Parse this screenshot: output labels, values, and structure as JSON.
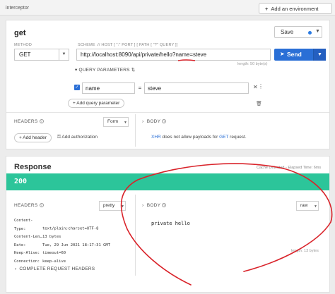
{
  "topbar": {
    "title": "interceptor",
    "add_env_label": "Add an environment",
    "add_env_icon": "plus-icon"
  },
  "request": {
    "name": "get",
    "save_label": "Save",
    "method_label": "METHOD",
    "method": "GET",
    "url_label": "SCHEME :// HOST [ \":\" PORT ] [ PATH [ \"?\" QUERY ]]",
    "url": "http://localhost:8090/api/private/hello?name=steve",
    "send_label": "Send",
    "length_hint": "length: 50 byte(s)",
    "query_params_label": "QUERY PARAMETERS",
    "params": [
      {
        "enabled": true,
        "key": "name",
        "value": "steve"
      }
    ],
    "add_param_label": "Add query parameter",
    "headers_label": "HEADERS",
    "body_label": "BODY",
    "body_format": "Form",
    "add_header_label": "Add header",
    "add_auth_label": "Add authorization",
    "xhr_note_prefix": "XHR",
    "xhr_note_mid": " does not allow payloads for ",
    "xhr_note_method": "GET",
    "xhr_note_suffix": " request."
  },
  "response": {
    "title": "Response",
    "meta": "Cache Detected - Elapsed Time: 6ms",
    "status_code": "200",
    "headers_label": "HEADERS",
    "headers_format": "pretty",
    "body_label": "BODY",
    "body_format": "raw",
    "headers": [
      {
        "key": "Content-Type:",
        "value": "text/plain;charset=UTF-8"
      },
      {
        "key": "Content-Len…",
        "value": "13 bytes"
      },
      {
        "key": "Date:",
        "value": "Tue, 29 Jun 2021 18:17:31 GMT"
      },
      {
        "key": "Keep-Alive:",
        "value": "timeout=60"
      },
      {
        "key": "Connection:",
        "value": "keep-alive"
      }
    ],
    "body_text": "private hello",
    "length_hint": "length: 13 bytes",
    "complete_headers_label": "COMPLETE REQUEST HEADERS"
  },
  "colors": {
    "accent": "#2a6fd6",
    "status_ok": "#2cc59a",
    "annotation": "#d9232a"
  }
}
